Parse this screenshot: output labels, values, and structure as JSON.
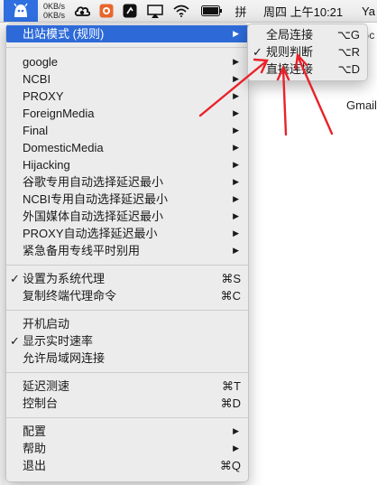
{
  "menubar": {
    "speed_up": "0KB/s",
    "speed_down": "0KB/s",
    "input_method": "拼",
    "clock": "周四 上午10:21",
    "user_partial": "Ya",
    "icons": [
      "surge-icon",
      "cloud-icon",
      "app-icon",
      "direction-icon",
      "airplay-icon",
      "wifi-icon",
      "battery-icon",
      "input-method-icon"
    ]
  },
  "background": {
    "gmail_label": "Gmail",
    "partial_text": "Gc"
  },
  "menu": {
    "outbound_mode": "出站模式 (规则)",
    "policies": [
      "google",
      "NCBI",
      "PROXY",
      "ForeignMedia",
      "Final",
      "DomesticMedia",
      "Hijacking",
      "谷歌专用自动选择延迟最小",
      "NCBI专用自动选择延迟最小",
      "外国媒体自动选择延迟最小",
      "PROXY自动选择延迟最小",
      "紧急备用专线平时别用"
    ],
    "set_system_proxy": "设置为系统代理",
    "set_system_proxy_shortcut": "⌘S",
    "copy_terminal_cmd": "复制终端代理命令",
    "copy_terminal_cmd_shortcut": "⌘C",
    "launch_at_login": "开机启动",
    "show_realtime_speed": "显示实时速率",
    "allow_lan": "允许局域网连接",
    "latency_test": "延迟测速",
    "latency_test_shortcut": "⌘T",
    "console": "控制台",
    "console_shortcut": "⌘D",
    "config": "配置",
    "help": "帮助",
    "quit": "退出",
    "quit_shortcut": "⌘Q",
    "check_glyph": "✓",
    "arrow_glyph": "▶"
  },
  "submenu": {
    "global": "全局连接",
    "global_shortcut": "⌥G",
    "rule": "规则判断",
    "rule_shortcut": "⌥R",
    "direct": "直接连接",
    "direct_shortcut": "⌥D"
  },
  "colors": {
    "highlight": "#2d6ad8",
    "annotation": "#e8222a",
    "surge_blue": "#2f6fe0"
  }
}
